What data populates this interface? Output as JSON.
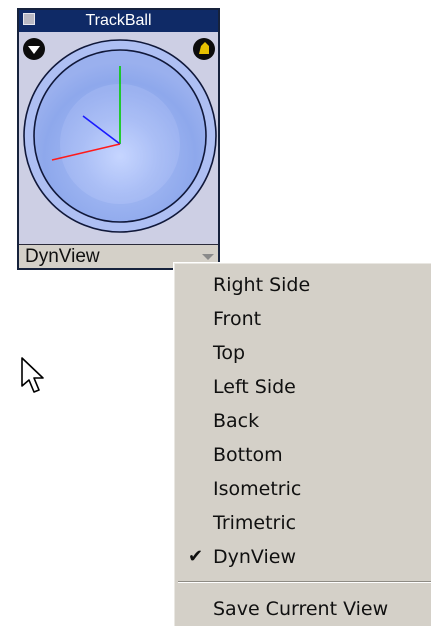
{
  "panel": {
    "title": "TrackBall",
    "view_select": {
      "value": "DynView"
    }
  },
  "icons": {
    "system_menu": "square-icon",
    "rotate_left": "down-arrow-circle-icon",
    "rotate_right": "yellow-arrow-circle-icon",
    "chevron": "chevron-down-icon",
    "cursor": "mouse-pointer-icon",
    "check": "check-icon"
  },
  "axes": {
    "x_color": "#ff0000",
    "y_color": "#00cc00",
    "z_color": "#0000ff"
  },
  "colors": {
    "title_bar": "#0f2a66",
    "panel_bg": "#cdcfe4",
    "menu_bg": "#d4d0c8"
  },
  "menu": {
    "items": [
      {
        "label": "Right Side",
        "checked": false
      },
      {
        "label": "Front",
        "checked": false
      },
      {
        "label": "Top",
        "checked": false
      },
      {
        "label": "Left Side",
        "checked": false
      },
      {
        "label": "Back",
        "checked": false
      },
      {
        "label": "Bottom",
        "checked": false
      },
      {
        "label": "Isometric",
        "checked": false
      },
      {
        "label": "Trimetric",
        "checked": false
      },
      {
        "label": "DynView",
        "checked": true
      }
    ],
    "check_mark": "✔",
    "footer_item": {
      "label": "Save Current View"
    }
  }
}
